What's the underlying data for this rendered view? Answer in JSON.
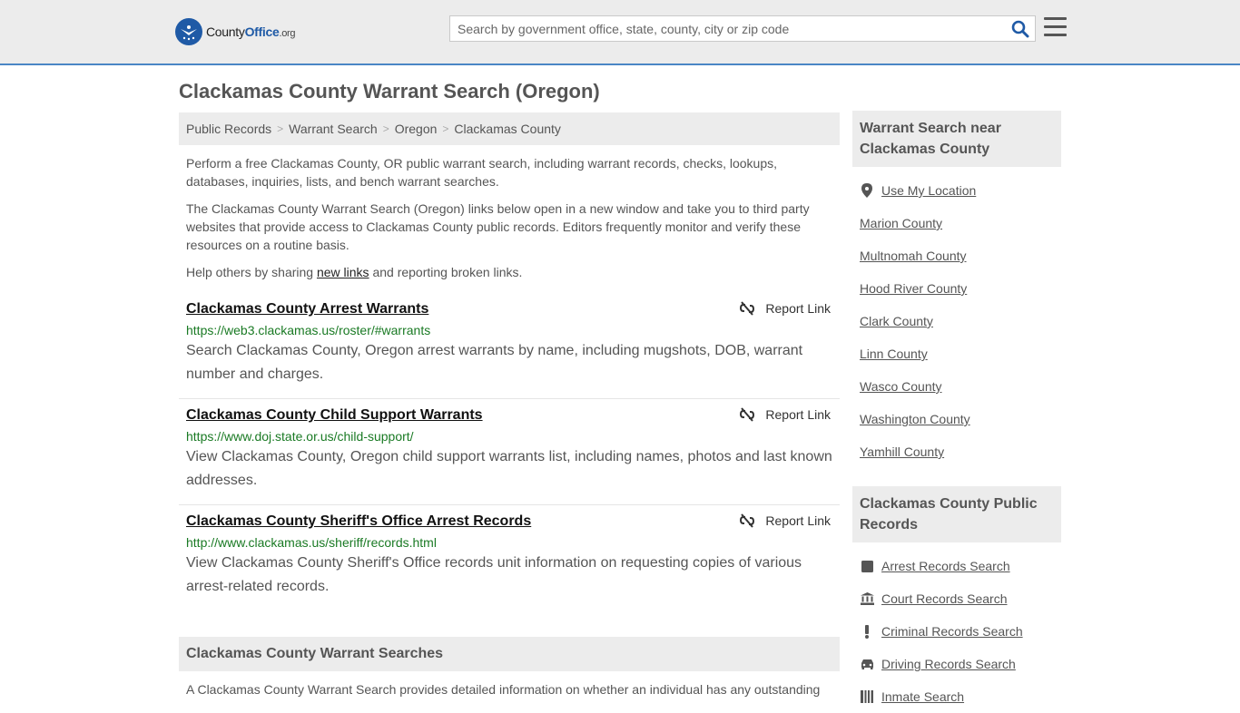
{
  "header": {
    "logo": {
      "name": "County",
      "highlight": "Office",
      "suffix": ".org"
    },
    "search_placeholder": "Search by government office, state, county, city or zip code"
  },
  "page": {
    "title": "Clackamas County Warrant Search (Oregon)"
  },
  "breadcrumb": [
    "Public Records",
    "Warrant Search",
    "Oregon",
    "Clackamas County"
  ],
  "intro": {
    "p1": "Perform a free Clackamas County, OR public warrant search, including warrant records, checks, lookups, databases, inquiries, lists, and bench warrant searches.",
    "p2": "The Clackamas County Warrant Search (Oregon) links below open in a new window and take you to third party websites that provide access to Clackamas County public records. Editors frequently monitor and verify these resources on a routine basis.",
    "p3_before": "Help others by sharing ",
    "p3_link": "new links",
    "p3_after": " and reporting broken links."
  },
  "report_label": "Report Link",
  "results": [
    {
      "title": "Clackamas County Arrest Warrants",
      "url": "https://web3.clackamas.us/roster/#warrants",
      "description": "Search Clackamas County, Oregon arrest warrants by name, including mugshots, DOB, warrant number and charges."
    },
    {
      "title": "Clackamas County Child Support Warrants",
      "url": "https://www.doj.state.or.us/child-support/",
      "description": "View Clackamas County, Oregon child support warrants list, including names, photos and last known addresses."
    },
    {
      "title": "Clackamas County Sheriff's Office Arrest Records",
      "url": "http://www.clackamas.us/sheriff/records.html",
      "description": "View Clackamas County Sheriff's Office records unit information on requesting copies of various arrest-related records."
    }
  ],
  "searches_section": {
    "title": "Clackamas County Warrant Searches",
    "text": "A Clackamas County Warrant Search provides detailed information on whether an individual has any outstanding"
  },
  "sidebar": {
    "nearby": {
      "title": "Warrant Search near Clackamas County",
      "use_location": "Use My Location",
      "items": [
        "Marion County",
        "Multnomah County",
        "Hood River County",
        "Clark County",
        "Linn County",
        "Wasco County",
        "Washington County",
        "Yamhill County"
      ]
    },
    "public_records": {
      "title": "Clackamas County Public Records",
      "items": [
        {
          "label": "Arrest Records Search",
          "icon": "square-icon"
        },
        {
          "label": "Court Records Search",
          "icon": "courthouse-icon"
        },
        {
          "label": "Criminal Records Search",
          "icon": "exclamation-icon"
        },
        {
          "label": "Driving Records Search",
          "icon": "car-icon"
        },
        {
          "label": "Inmate Search",
          "icon": "inmate-icon"
        }
      ]
    }
  },
  "colors": {
    "accent": "#1f5aa6",
    "url_green": "#1a7a24",
    "panel_gray": "#ececec"
  }
}
